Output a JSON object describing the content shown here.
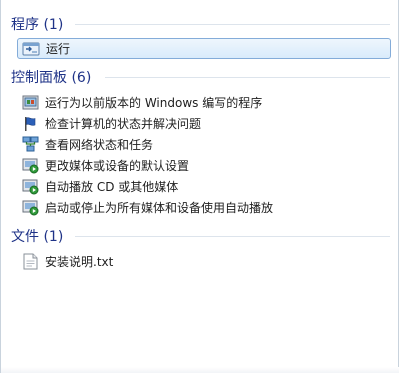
{
  "groups": {
    "programs": {
      "header": "程序 (1)",
      "items": [
        {
          "label": "运行",
          "icon": "run-dialog-icon"
        }
      ]
    },
    "control_panel": {
      "header": "控制面板 (6)",
      "items": [
        {
          "label": "运行为以前版本的 Windows 编写的程序",
          "icon": "compatibility-icon"
        },
        {
          "label": "检查计算机的状态并解决问题",
          "icon": "action-center-flag-icon"
        },
        {
          "label": "查看网络状态和任务",
          "icon": "network-icon"
        },
        {
          "label": "更改媒体或设备的默认设置",
          "icon": "autoplay-icon"
        },
        {
          "label": "自动播放 CD 或其他媒体",
          "icon": "autoplay-icon"
        },
        {
          "label": "启动或停止为所有媒体和设备使用自动播放",
          "icon": "autoplay-icon"
        }
      ]
    },
    "files": {
      "header": "文件 (1)",
      "items": [
        {
          "label": "安装说明.txt",
          "icon": "text-file-icon"
        }
      ]
    }
  },
  "colors": {
    "header_text": "#1e3287",
    "selection_border": "#84acd9",
    "rule": "#dde4ec"
  }
}
